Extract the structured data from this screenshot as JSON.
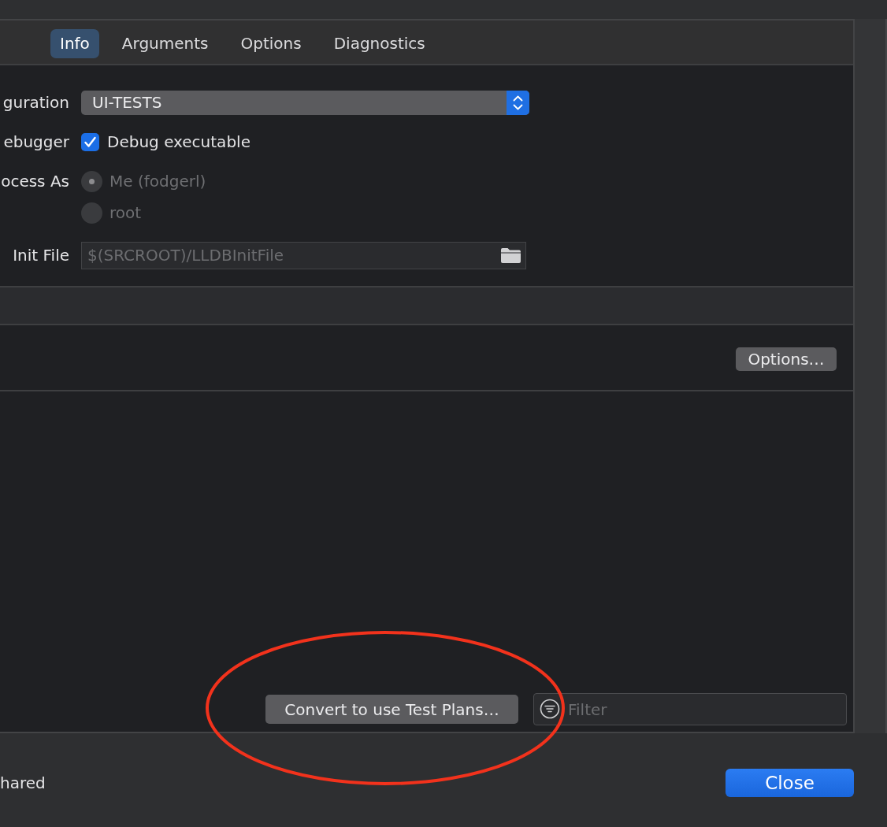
{
  "tabs": [
    {
      "label": "Info",
      "selected": true
    },
    {
      "label": "Arguments",
      "selected": false
    },
    {
      "label": "Options",
      "selected": false
    },
    {
      "label": "Diagnostics",
      "selected": false
    }
  ],
  "settings": {
    "rows": [
      {
        "kind": "popup",
        "label": "guration",
        "value": "UI-TESTS"
      },
      {
        "kind": "checkbox",
        "label": "ebugger",
        "option": "Debug executable",
        "checked": true
      },
      {
        "kind": "radio",
        "label": "ocess As",
        "options": [
          {
            "label": "Me (fodgerl)",
            "selected": true,
            "disabled": true
          },
          {
            "label": "root",
            "selected": false,
            "disabled": true
          }
        ]
      },
      {
        "kind": "path",
        "label": "Init File",
        "placeholder": "$(SRCROOT)/LLDBInitFile"
      }
    ]
  },
  "options_button": "Options…",
  "convert_button": "Convert to use Test Plans…",
  "filter": {
    "placeholder": "Filter"
  },
  "footer": {
    "label": "hared",
    "close_button": "Close"
  }
}
